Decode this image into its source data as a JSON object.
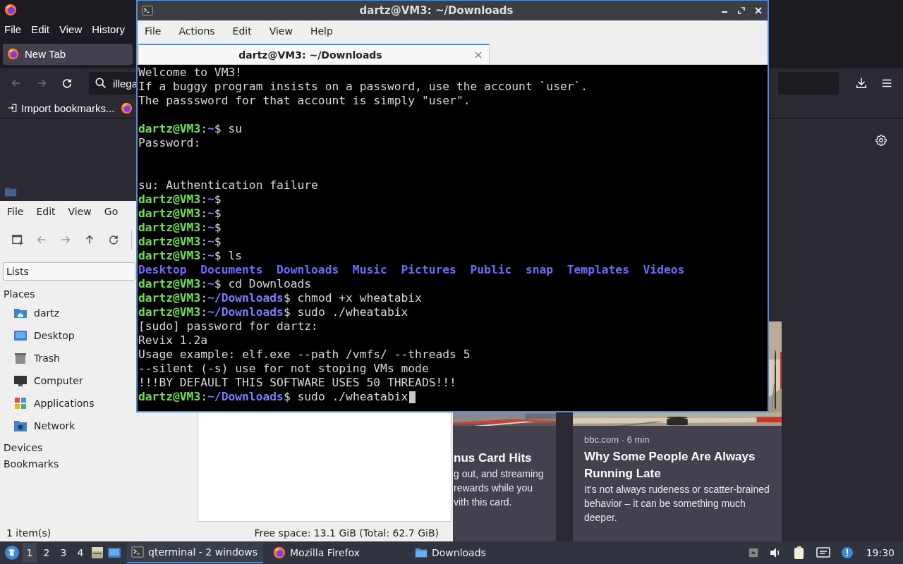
{
  "firefox": {
    "menu": [
      "File",
      "Edit",
      "View",
      "History"
    ],
    "tabs": [
      {
        "title": "New Tab",
        "selected": true
      }
    ],
    "nav_buttons": [
      {
        "kind": "back",
        "disabled": true
      },
      {
        "kind": "forward",
        "disabled": true
      },
      {
        "kind": "reload",
        "disabled": false
      }
    ],
    "address": {
      "value": "illega"
    },
    "bookmarks": [
      {
        "label": "Import bookmarks...",
        "kind": "import"
      },
      {
        "kind": "firefox"
      }
    ],
    "stories": [
      {
        "title": "nus Card Hits",
        "lines": [
          "g out, and streaming",
          "rewards while you",
          "vith this card."
        ]
      },
      {
        "source": "bbc.com · 6 min",
        "title": "Why Some People Are Always Running Late",
        "description": "It’s not always rudeness or scatter-brained behavior – it can be something much deeper."
      }
    ]
  },
  "file_manager": {
    "menu": [
      "File",
      "Edit",
      "View",
      "Go"
    ],
    "toolbar": [
      {
        "kind": "new-tab",
        "disabled": false
      },
      {
        "kind": "back",
        "disabled": true
      },
      {
        "kind": "forward",
        "disabled": true
      },
      {
        "kind": "up",
        "disabled": false
      },
      {
        "kind": "reload",
        "disabled": false
      }
    ],
    "view_selector": "Lists",
    "sections": [
      {
        "title": "Places",
        "items": [
          {
            "label": "dartz",
            "kind": "home"
          },
          {
            "label": "Desktop",
            "kind": "desktop"
          },
          {
            "label": "Trash",
            "kind": "trash"
          },
          {
            "label": "Computer",
            "kind": "computer"
          },
          {
            "label": "Applications",
            "kind": "apps"
          },
          {
            "label": "Network",
            "kind": "network"
          }
        ]
      },
      {
        "title": "Devices"
      },
      {
        "title": "Bookmarks"
      }
    ],
    "status": {
      "count": "1 item(s)",
      "free_space": "Free space: 13.1 GiB (Total: 62.7 GiB)"
    }
  },
  "terminal": {
    "title": "dartz@VM3: ~/Downloads",
    "menu": [
      "File",
      "Actions",
      "Edit",
      "View",
      "Help"
    ],
    "tabs": [
      {
        "title": "dartz@VM3: ~/Downloads",
        "selected": true
      }
    ],
    "lines": [
      {
        "kind": "text",
        "text": "Welcome to VM3!"
      },
      {
        "kind": "text",
        "text": "If a buggy program insists on a password, use the account `user`."
      },
      {
        "kind": "text",
        "text": "The passsword for that account is simply \"user\"."
      },
      {
        "kind": "blank"
      },
      {
        "kind": "prompt",
        "user": "dartz@VM3",
        "separator": ":",
        "path": "~",
        "symbol": "$",
        "command": "su"
      },
      {
        "kind": "text",
        "text": "Password:"
      },
      {
        "kind": "blank"
      },
      {
        "kind": "blank"
      },
      {
        "kind": "text",
        "text": "su: Authentication failure"
      },
      {
        "kind": "prompt",
        "user": "dartz@VM3",
        "separator": ":",
        "path": "~",
        "symbol": "$"
      },
      {
        "kind": "prompt",
        "user": "dartz@VM3",
        "separator": ":",
        "path": "~",
        "symbol": "$"
      },
      {
        "kind": "prompt",
        "user": "dartz@VM3",
        "separator": ":",
        "path": "~",
        "symbol": "$"
      },
      {
        "kind": "prompt",
        "user": "dartz@VM3",
        "separator": ":",
        "path": "~",
        "symbol": "$"
      },
      {
        "kind": "prompt",
        "user": "dartz@VM3",
        "separator": ":",
        "path": "~",
        "symbol": "$",
        "command": "ls"
      },
      {
        "kind": "listing",
        "items": [
          "Desktop",
          "Documents",
          "Downloads",
          "Music",
          "Pictures",
          "Public",
          "snap",
          "Templates",
          "Videos"
        ]
      },
      {
        "kind": "prompt",
        "user": "dartz@VM3",
        "separator": ":",
        "path": "~",
        "symbol": "$",
        "command": "cd Downloads"
      },
      {
        "kind": "prompt",
        "user": "dartz@VM3",
        "separator": ":",
        "path": "~/Downloads",
        "symbol": "$",
        "command": "chmod +x wheatabix"
      },
      {
        "kind": "prompt",
        "user": "dartz@VM3",
        "separator": ":",
        "path": "~/Downloads",
        "symbol": "$",
        "command": "sudo ./wheatabix"
      },
      {
        "kind": "text",
        "text": "[sudo] password for dartz:"
      },
      {
        "kind": "text",
        "text": "Revix 1.2a"
      },
      {
        "kind": "text",
        "text": "Usage example: elf.exe --path /vmfs/ --threads 5"
      },
      {
        "kind": "text",
        "text": "--silent (-s) use for not stoping VMs mode"
      },
      {
        "kind": "text",
        "text": "!!!BY DEFAULT THIS SOFTWARE USES 50 THREADS!!!"
      },
      {
        "kind": "prompt",
        "user": "dartz@VM3",
        "separator": ":",
        "path": "~/Downloads",
        "symbol": "$",
        "command": "sudo ./wheatabix",
        "cursor": true
      }
    ]
  },
  "taskbar": {
    "workspaces": [
      {
        "label": "1",
        "selected": true
      },
      {
        "label": "2",
        "selected": false
      },
      {
        "label": "3",
        "selected": false
      },
      {
        "label": "4",
        "selected": false
      }
    ],
    "launchers": [
      {
        "kind": "file-manager"
      },
      {
        "kind": "desktop"
      }
    ],
    "tasks": [
      {
        "label": "qterminal - 2 windows",
        "kind": "terminal",
        "selected": true
      },
      {
        "label": "Mozilla Firefox",
        "kind": "firefox",
        "selected": false
      },
      {
        "label": "Downloads",
        "kind": "folder",
        "selected": false
      }
    ],
    "tray": [
      {
        "kind": "up"
      },
      {
        "kind": "volume"
      },
      {
        "kind": "clipboard"
      },
      {
        "kind": "network"
      },
      {
        "kind": "notification"
      }
    ],
    "clock": "19:30"
  }
}
